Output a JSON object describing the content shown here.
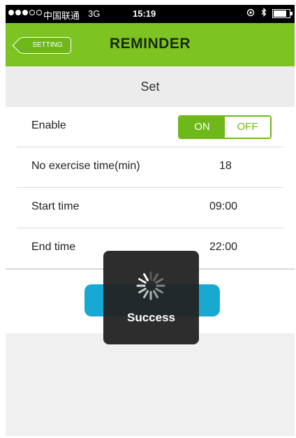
{
  "status_bar": {
    "carrier": "中国联通",
    "network": "3G",
    "time": "15:19"
  },
  "nav": {
    "back_label": "SETTING",
    "title": "REMINDER"
  },
  "section": {
    "title": "Set"
  },
  "rows": {
    "enable": {
      "label": "Enable",
      "on_label": "ON",
      "off_label": "OFF",
      "selected": "ON"
    },
    "no_exercise": {
      "label": "No exercise time(min)",
      "value": "18"
    },
    "start_time": {
      "label": "Start time",
      "value": "09:00"
    },
    "end_time": {
      "label": "End time",
      "value": "22:00"
    }
  },
  "hud": {
    "message": "Success"
  },
  "colors": {
    "nav_green": "#7dc423",
    "toggle_green": "#6fb81a",
    "button_blue": "#18a9d2",
    "hud_bg": "#222222"
  }
}
